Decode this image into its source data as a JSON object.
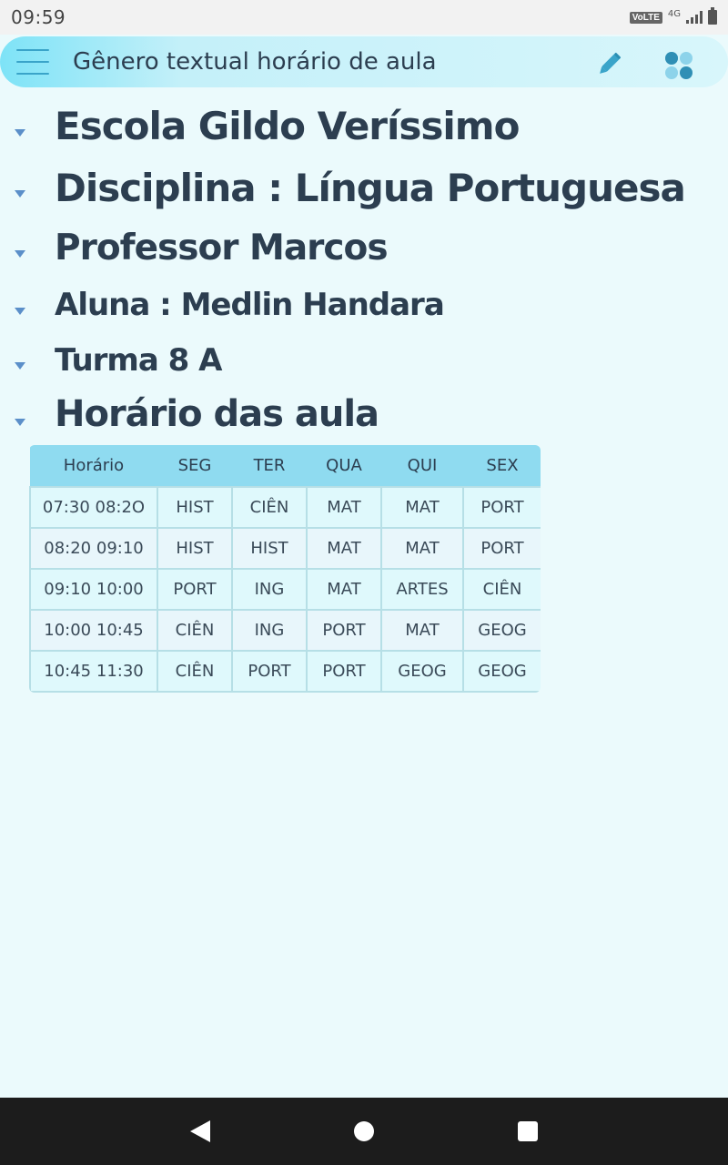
{
  "status_bar": {
    "time": "09:59",
    "volte": "VoLTE",
    "network": "4G"
  },
  "app_bar": {
    "title": "Gênero textual horário de aula",
    "icons": [
      "menu-icon",
      "pencil-icon",
      "apps-icon"
    ],
    "accent_color": "#3aa4c9"
  },
  "outline": {
    "items": [
      {
        "label": "Escola Gildo Veríssimo"
      },
      {
        "label": "Disciplina : Língua Portuguesa"
      },
      {
        "label": "Professor Marcos"
      },
      {
        "label": "Aluna : Medlin Handara"
      },
      {
        "label": "Turma 8 A"
      },
      {
        "label": "Horário das aula"
      }
    ]
  },
  "table": {
    "headers": [
      "Horário",
      "SEG",
      "TER",
      "QUA",
      "QUI",
      "SEX"
    ],
    "rows": [
      [
        "07:30 08:2O",
        "HIST",
        "CIÊN",
        "MAT",
        "MAT",
        "PORT"
      ],
      [
        "08:20 09:10",
        "HIST",
        "HIST",
        "MAT",
        "MAT",
        "PORT"
      ],
      [
        "09:10 10:00",
        "PORT",
        "ING",
        "MAT",
        "ARTES",
        "CIÊN"
      ],
      [
        "10:00 10:45",
        "CIÊN",
        "ING",
        "PORT",
        "MAT",
        "GEOG"
      ],
      [
        "10:45 11:30",
        "CIÊN",
        "PORT",
        "PORT",
        "GEOG",
        "GEOG"
      ]
    ]
  },
  "nav_bar": {
    "icons": [
      "back-icon",
      "home-icon",
      "recents-icon"
    ]
  }
}
